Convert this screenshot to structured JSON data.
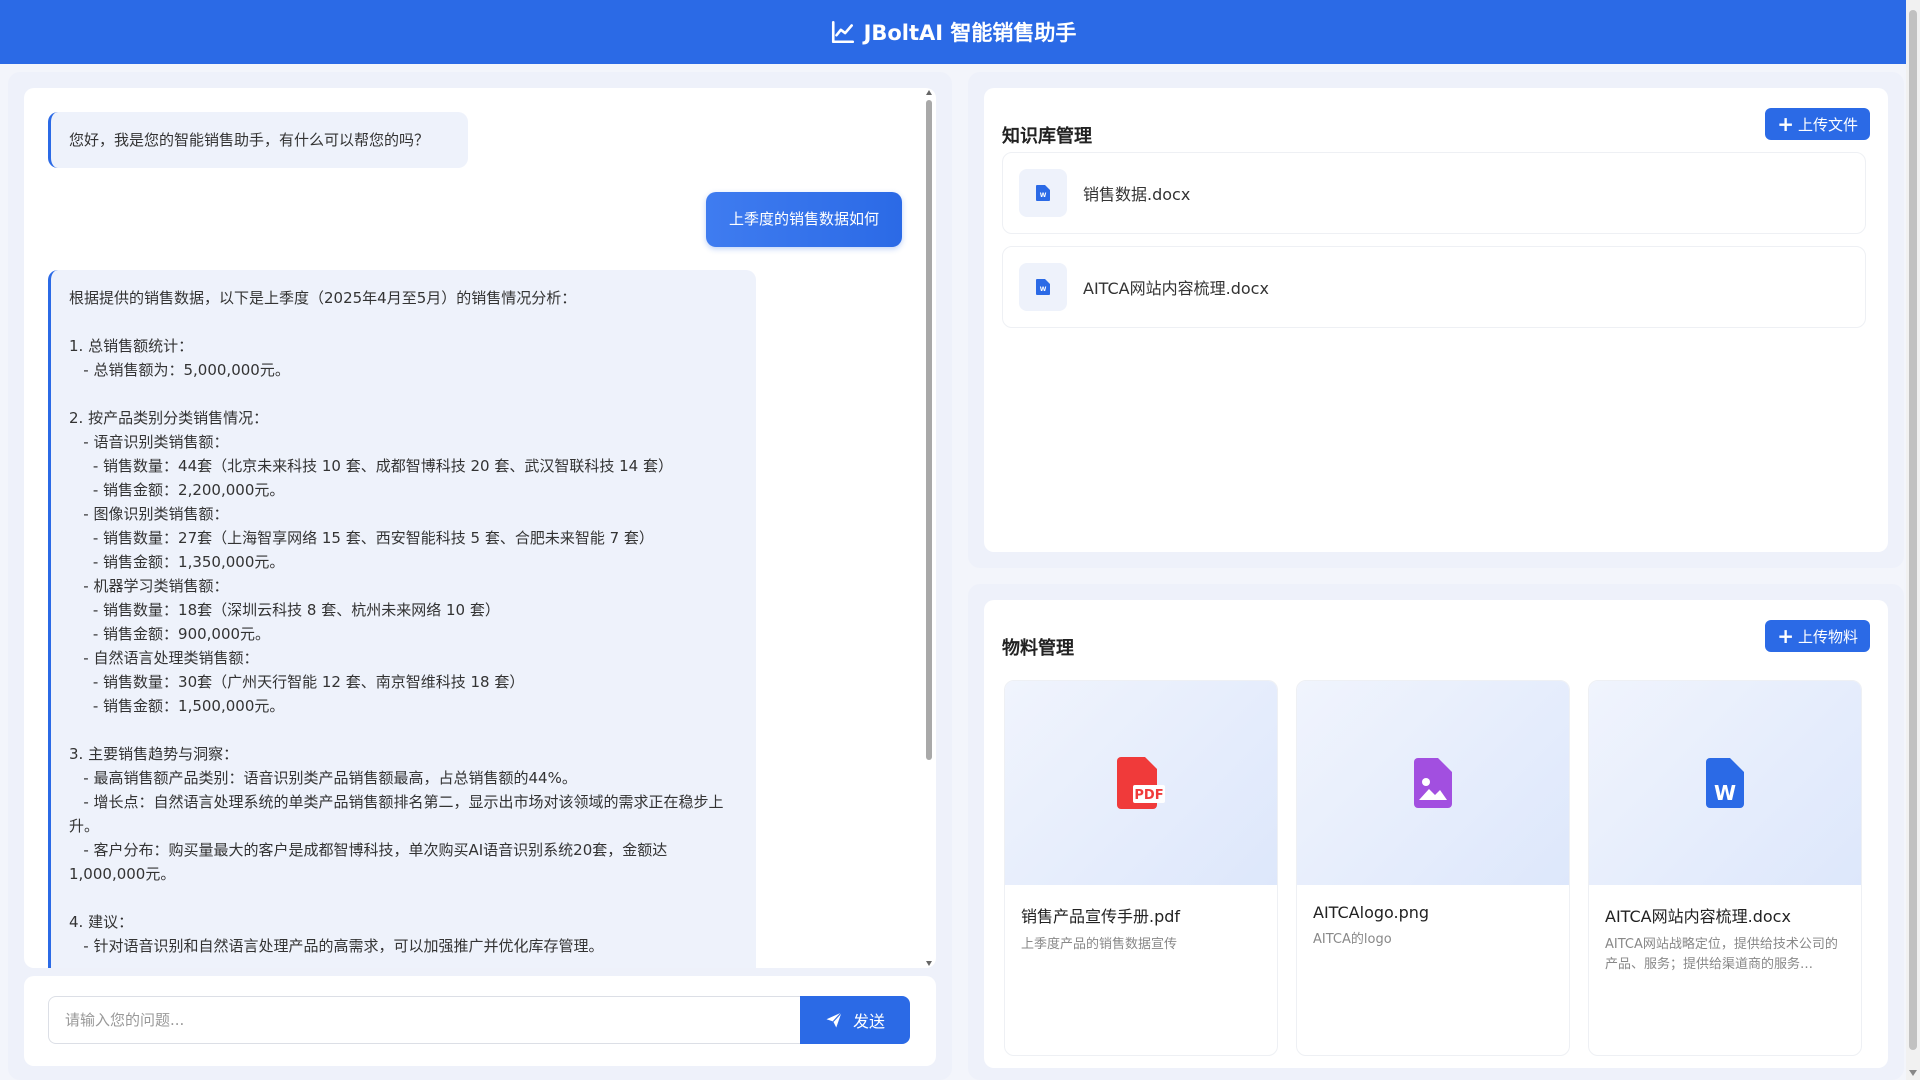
{
  "header": {
    "title": "JBoltAI 智能销售助手",
    "icon": "line-chart-icon",
    "color": "#2b6ae6"
  },
  "chat": {
    "messages": [
      {
        "role": "assistant",
        "text": "您好，我是您的智能销售助手，有什么可以帮您的吗？"
      },
      {
        "role": "user",
        "text": "上季度的销售数据如何"
      },
      {
        "role": "assistant",
        "lines": [
          "根据提供的销售数据，以下是上季度（2025年4月至5月）的销售情况分析：",
          "",
          "1. 总销售额统计：",
          "   - 总销售额为：5,000,000元。",
          "",
          "2. 按产品类别分类销售情况：",
          "   - 语音识别类销售额：",
          "     - 销售数量：44套（北京未来科技 10 套、成都智博科技 20 套、武汉智联科技 14 套）",
          "     - 销售金额：2,200,000元。",
          "   - 图像识别类销售额：",
          "     - 销售数量：27套（上海智享网络 15 套、西安智能科技 5 套、合肥未来智能 7 套）",
          "     - 销售金额：1,350,000元。",
          "   - 机器学习类销售额：",
          "     - 销售数量：18套（深圳云科技 8 套、杭州未来网络 10 套）",
          "     - 销售金额：900,000元。",
          "   - 自然语言处理类销售额：",
          "     - 销售数量：30套（广州天行智能 12 套、南京智维科技 18 套）",
          "     - 销售金额：1,500,000元。",
          "",
          "3. 主要销售趋势与洞察：",
          "   - 最高销售额产品类别：语音识别类产品销售额最高，占总销售额的44%。",
          "   - 增长点：自然语言处理系统的单类产品销售额排名第二，显示出市场对该领域的需求正在稳步上升。",
          "   - 客户分布：购买量最大的客户是成都智博科技，单次购买AI语音识别系统20套，金额达1,000,000元。",
          "",
          "4. 建议：",
          "   - 针对语音识别和自然语言处理产品的高需求，可以加强推广并优化库存管理。"
        ]
      }
    ],
    "input_placeholder": "请输入您的问题...",
    "send_label": "发送"
  },
  "knowledge": {
    "title": "知识库管理",
    "upload_label": "上传文件",
    "files": [
      {
        "name": "销售数据.docx",
        "icon": "word-icon"
      },
      {
        "name": "AITCA网站内容梳理.docx",
        "icon": "word-icon"
      }
    ]
  },
  "materials": {
    "title": "物料管理",
    "upload_label": "上传物料",
    "items": [
      {
        "name": "销售产品宣传手册.pdf",
        "desc": "上季度产品的销售数据宣传",
        "icon": "pdf-icon",
        "color": "#f03a3a"
      },
      {
        "name": "AITCAlogo.png",
        "desc": "AITCA的logo",
        "icon": "image-icon",
        "color": "#a24fe0"
      },
      {
        "name": "AITCA网站内容梳理.docx",
        "desc": "AITCA网站战略定位，提供给技术公司的产品、服务；提供给渠道商的服务…",
        "icon": "word-icon",
        "color": "#2b6ae6"
      }
    ]
  }
}
